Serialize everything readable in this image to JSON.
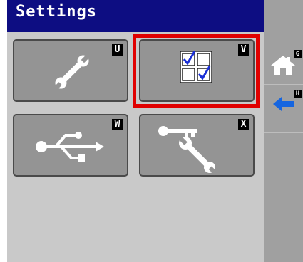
{
  "title": "Settings",
  "tiles": [
    {
      "key": "U",
      "icon": "wrench-icon"
    },
    {
      "key": "V",
      "icon": "checkbox-grid-icon"
    },
    {
      "key": "W",
      "icon": "usb-icon"
    },
    {
      "key": "X",
      "icon": "key-wrench-icon"
    }
  ],
  "side": {
    "home": {
      "key": "G",
      "icon": "home-icon"
    },
    "back": {
      "key": "H",
      "icon": "back-arrow-icon"
    }
  },
  "colors": {
    "title_bar": "#0d0d82",
    "selection": "#e00000",
    "back_arrow": "#1565e0",
    "check": "#1a2fd6"
  }
}
